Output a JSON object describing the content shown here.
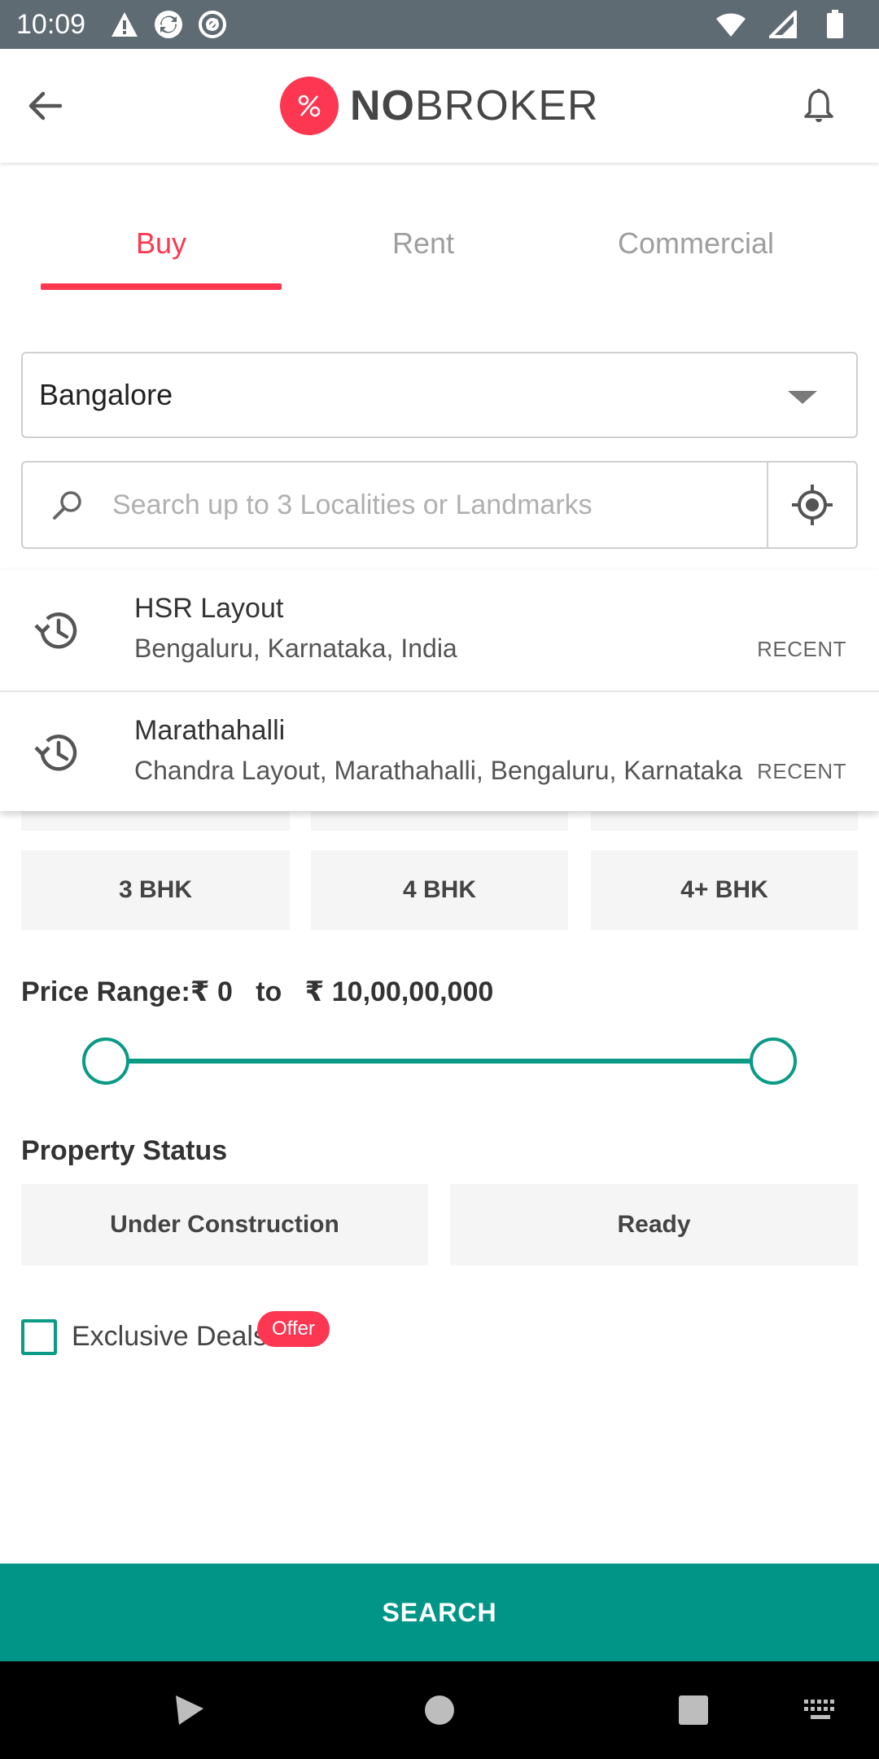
{
  "status_bar": {
    "time": "10:09",
    "icons_left": [
      "alert-icon",
      "sync-icon",
      "at-icon"
    ],
    "icons_right": [
      "wifi-icon",
      "signal-icon",
      "battery-icon"
    ]
  },
  "app_bar": {
    "logo_bold": "NO",
    "logo_regular": "BROKER",
    "back_icon": "arrow-left-icon",
    "notification_icon": "bell-icon"
  },
  "tabs": [
    {
      "label": "Buy",
      "active": true
    },
    {
      "label": "Rent",
      "active": false
    },
    {
      "label": "Commercial",
      "active": false
    }
  ],
  "city_select": {
    "value": "Bangalore"
  },
  "search": {
    "placeholder": "Search up to 3 Localities or Landmarks",
    "value": ""
  },
  "suggestions": [
    {
      "title": "HSR Layout",
      "subtitle": "Bengaluru, Karnataka, India",
      "tag": "RECENT"
    },
    {
      "title": "Marathahalli",
      "subtitle": "Chandra Layout, Marathahalli, Bengaluru, Karnataka",
      "tag": "RECENT"
    }
  ],
  "bhk_options": [
    "3 BHK",
    "4 BHK",
    "4+ BHK"
  ],
  "price_range": {
    "label": "Price Range:",
    "min": "₹ 0",
    "separator": "to",
    "max": "₹ 10,00,00,000"
  },
  "property_status": {
    "label": "Property Status",
    "options": [
      "Under Construction",
      "Ready"
    ]
  },
  "exclusive_deals": {
    "label": "Exclusive Deals",
    "badge": "Offer",
    "checked": false
  },
  "search_button": {
    "label": "SEARCH"
  },
  "colors": {
    "brand": "#fd3752",
    "accent": "#009587",
    "status_bar": "#5f6b73"
  }
}
